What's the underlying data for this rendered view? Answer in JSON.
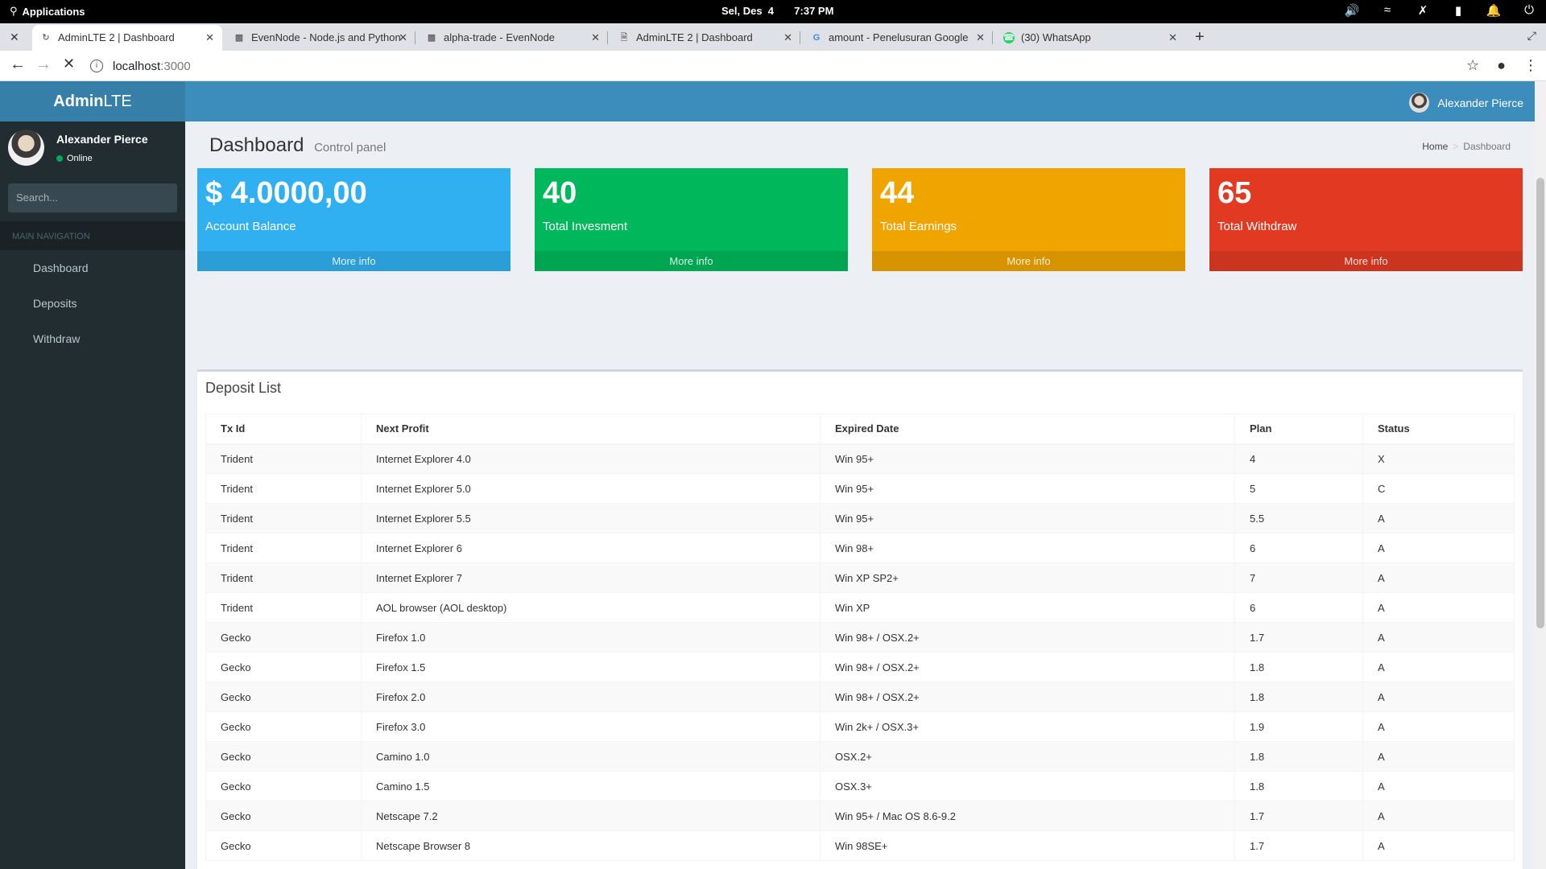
{
  "os": {
    "apps_label": "Applications",
    "date": "Sel, Des  4",
    "time": "7:37 PM"
  },
  "browser": {
    "tabs": [
      {
        "title": "AdminLTE 2 | Dashboard",
        "icon": "loading-icon"
      },
      {
        "title": "EvenNode - Node.js and Python",
        "icon": "evennode-icon"
      },
      {
        "title": "alpha-trade - EvenNode",
        "icon": "evennode-icon"
      },
      {
        "title": "AdminLTE 2 | Dashboard",
        "icon": "page-icon"
      },
      {
        "title": "amount - Penelusuran Google",
        "icon": "google-icon"
      },
      {
        "title": "(30) WhatsApp",
        "icon": "whatsapp-icon"
      }
    ],
    "url_host": "localhost",
    "url_port": ":3000"
  },
  "app": {
    "logo_bold": "Admin",
    "logo_light": "LTE",
    "navbar_user": "Alexander Pierce",
    "sidebar": {
      "user_name": "Alexander Pierce",
      "user_status": "Online",
      "search_placeholder": "Search...",
      "nav_header": "MAIN NAVIGATION",
      "items": [
        {
          "label": "Dashboard"
        },
        {
          "label": "Deposits"
        },
        {
          "label": "Withdraw"
        }
      ]
    },
    "header": {
      "title": "Dashboard",
      "subtitle": "Control panel",
      "breadcrumb_home": "Home",
      "breadcrumb_current": "Dashboard"
    },
    "stat_boxes": [
      {
        "value": "$ 4.0000,00",
        "label": "Account Balance",
        "more": "More info",
        "color": "#30b0f0"
      },
      {
        "value": "40",
        "label": "Total Invesment",
        "more": "More info",
        "color": "#00b85c"
      },
      {
        "value": "44",
        "label": "Total Earnings",
        "more": "More info",
        "color": "#f0a400"
      },
      {
        "value": "65",
        "label": "Total Withdraw",
        "more": "More info",
        "color": "#e23a22"
      }
    ],
    "deposit_list": {
      "title": "Deposit List",
      "columns": [
        "Tx Id",
        "Next Profit",
        "Expired Date",
        "Plan",
        "Status"
      ],
      "rows": [
        [
          "Trident",
          "Internet Explorer 4.0",
          "Win 95+",
          "4",
          "X"
        ],
        [
          "Trident",
          "Internet Explorer 5.0",
          "Win 95+",
          "5",
          "C"
        ],
        [
          "Trident",
          "Internet Explorer 5.5",
          "Win 95+",
          "5.5",
          "A"
        ],
        [
          "Trident",
          "Internet Explorer 6",
          "Win 98+",
          "6",
          "A"
        ],
        [
          "Trident",
          "Internet Explorer 7",
          "Win XP SP2+",
          "7",
          "A"
        ],
        [
          "Trident",
          "AOL browser (AOL desktop)",
          "Win XP",
          "6",
          "A"
        ],
        [
          "Gecko",
          "Firefox 1.0",
          "Win 98+ / OSX.2+",
          "1.7",
          "A"
        ],
        [
          "Gecko",
          "Firefox 1.5",
          "Win 98+ / OSX.2+",
          "1.8",
          "A"
        ],
        [
          "Gecko",
          "Firefox 2.0",
          "Win 98+ / OSX.2+",
          "1.8",
          "A"
        ],
        [
          "Gecko",
          "Firefox 3.0",
          "Win 2k+ / OSX.3+",
          "1.9",
          "A"
        ],
        [
          "Gecko",
          "Camino 1.0",
          "OSX.2+",
          "1.8",
          "A"
        ],
        [
          "Gecko",
          "Camino 1.5",
          "OSX.3+",
          "1.8",
          "A"
        ],
        [
          "Gecko",
          "Netscape 7.2",
          "Win 95+ / Mac OS 8.6-9.2",
          "1.7",
          "A"
        ],
        [
          "Gecko",
          "Netscape Browser 8",
          "Win 98SE+",
          "1.7",
          "A"
        ]
      ]
    }
  }
}
